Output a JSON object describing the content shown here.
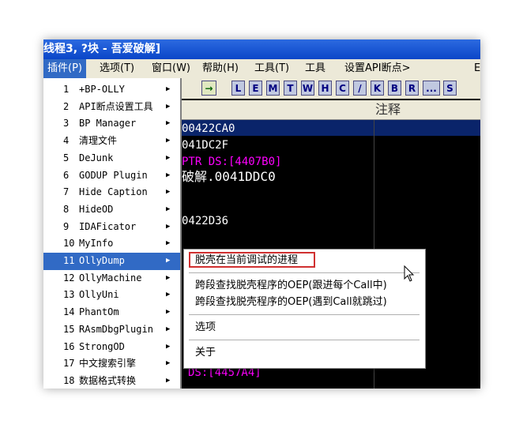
{
  "window": {
    "title": "线程3, ?块 - 吾爱破解]"
  },
  "menubar": {
    "items": [
      {
        "label": "插件(P)",
        "active": true
      },
      {
        "label": "选项(T)"
      },
      {
        "label": "窗口(W)"
      },
      {
        "label": "帮助(H)"
      },
      {
        "label": "工具(T)"
      },
      {
        "label": "工具"
      },
      {
        "label": "设置API断点>"
      },
      {
        "label": "E"
      }
    ]
  },
  "toolbar": {
    "buttons": [
      "L",
      "E",
      "M",
      "T",
      "W",
      "H",
      "C",
      "/",
      "K",
      "B",
      "R",
      "...",
      "S"
    ]
  },
  "columns": {
    "comment": "注释"
  },
  "code_lines": [
    {
      "text": "00422CA0",
      "color": "#ffffff"
    },
    {
      "text": "041DC2F",
      "color": "#ffffff"
    },
    {
      "text": "PTR DS:[4407B0]",
      "color": "#ff00ff"
    },
    {
      "text": "破解.0041DDC0",
      "color": "#ffffff"
    },
    {
      "text": "0422D36",
      "color": "#ffffff"
    },
    {
      "text": "DS:[4457A4]",
      "color": "#ff00ff"
    }
  ],
  "plugins_menu": {
    "items": [
      {
        "num": "1",
        "label": "+BP-OLLY"
      },
      {
        "num": "2",
        "label": "API断点设置工具"
      },
      {
        "num": "3",
        "label": "BP Manager"
      },
      {
        "num": "4",
        "label": "清理文件"
      },
      {
        "num": "5",
        "label": "DeJunk"
      },
      {
        "num": "6",
        "label": "GODUP Plugin"
      },
      {
        "num": "7",
        "label": "Hide Caption"
      },
      {
        "num": "8",
        "label": "HideOD"
      },
      {
        "num": "9",
        "label": "IDAFicator"
      },
      {
        "num": "10",
        "label": "MyInfo"
      },
      {
        "num": "11",
        "label": "OllyDump",
        "highlighted": true
      },
      {
        "num": "12",
        "label": "OllyMachine"
      },
      {
        "num": "13",
        "label": "OllyUni"
      },
      {
        "num": "14",
        "label": "PhantOm"
      },
      {
        "num": "15",
        "label": "RAsmDbgPlugin"
      },
      {
        "num": "16",
        "label": "StrongOD"
      },
      {
        "num": "17",
        "label": "中文搜索引擎"
      },
      {
        "num": "18",
        "label": "数据格式转换"
      }
    ]
  },
  "ollydump_menu": {
    "dump": "脱壳在当前调试的进程",
    "find_oep_stepinto": "跨段查找脱壳程序的OEP(跟进每个Call中)",
    "find_oep_stepover": "跨段查找脱壳程序的OEP(遇到Call就跳过)",
    "options": "选项",
    "about": "关于"
  },
  "colors": {
    "highlight": "#316ac5",
    "titlebar": "#0a46c8",
    "magenta": "#ff00ff",
    "redbox": "#d03030"
  }
}
